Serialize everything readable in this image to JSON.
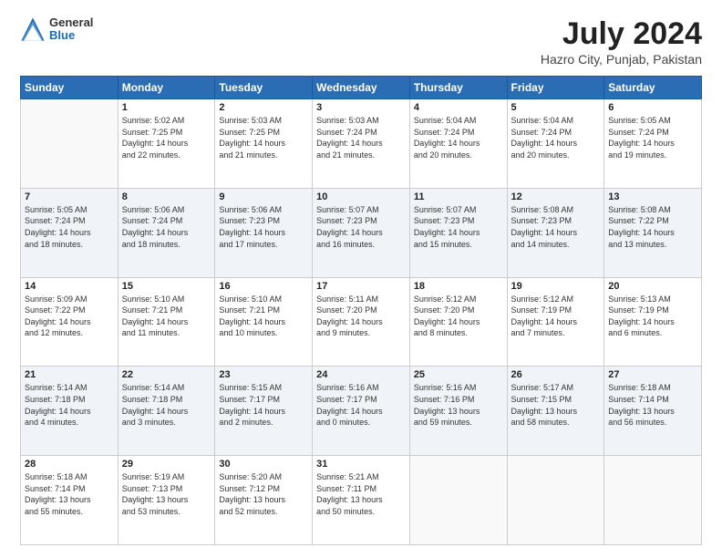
{
  "header": {
    "logo_general": "General",
    "logo_blue": "Blue",
    "month_year": "July 2024",
    "location": "Hazro City, Punjab, Pakistan"
  },
  "days_of_week": [
    "Sunday",
    "Monday",
    "Tuesday",
    "Wednesday",
    "Thursday",
    "Friday",
    "Saturday"
  ],
  "weeks": [
    [
      {
        "day": "",
        "info": ""
      },
      {
        "day": "1",
        "info": "Sunrise: 5:02 AM\nSunset: 7:25 PM\nDaylight: 14 hours\nand 22 minutes."
      },
      {
        "day": "2",
        "info": "Sunrise: 5:03 AM\nSunset: 7:25 PM\nDaylight: 14 hours\nand 21 minutes."
      },
      {
        "day": "3",
        "info": "Sunrise: 5:03 AM\nSunset: 7:24 PM\nDaylight: 14 hours\nand 21 minutes."
      },
      {
        "day": "4",
        "info": "Sunrise: 5:04 AM\nSunset: 7:24 PM\nDaylight: 14 hours\nand 20 minutes."
      },
      {
        "day": "5",
        "info": "Sunrise: 5:04 AM\nSunset: 7:24 PM\nDaylight: 14 hours\nand 20 minutes."
      },
      {
        "day": "6",
        "info": "Sunrise: 5:05 AM\nSunset: 7:24 PM\nDaylight: 14 hours\nand 19 minutes."
      }
    ],
    [
      {
        "day": "7",
        "info": "Sunrise: 5:05 AM\nSunset: 7:24 PM\nDaylight: 14 hours\nand 18 minutes."
      },
      {
        "day": "8",
        "info": "Sunrise: 5:06 AM\nSunset: 7:24 PM\nDaylight: 14 hours\nand 18 minutes."
      },
      {
        "day": "9",
        "info": "Sunrise: 5:06 AM\nSunset: 7:23 PM\nDaylight: 14 hours\nand 17 minutes."
      },
      {
        "day": "10",
        "info": "Sunrise: 5:07 AM\nSunset: 7:23 PM\nDaylight: 14 hours\nand 16 minutes."
      },
      {
        "day": "11",
        "info": "Sunrise: 5:07 AM\nSunset: 7:23 PM\nDaylight: 14 hours\nand 15 minutes."
      },
      {
        "day": "12",
        "info": "Sunrise: 5:08 AM\nSunset: 7:23 PM\nDaylight: 14 hours\nand 14 minutes."
      },
      {
        "day": "13",
        "info": "Sunrise: 5:08 AM\nSunset: 7:22 PM\nDaylight: 14 hours\nand 13 minutes."
      }
    ],
    [
      {
        "day": "14",
        "info": "Sunrise: 5:09 AM\nSunset: 7:22 PM\nDaylight: 14 hours\nand 12 minutes."
      },
      {
        "day": "15",
        "info": "Sunrise: 5:10 AM\nSunset: 7:21 PM\nDaylight: 14 hours\nand 11 minutes."
      },
      {
        "day": "16",
        "info": "Sunrise: 5:10 AM\nSunset: 7:21 PM\nDaylight: 14 hours\nand 10 minutes."
      },
      {
        "day": "17",
        "info": "Sunrise: 5:11 AM\nSunset: 7:20 PM\nDaylight: 14 hours\nand 9 minutes."
      },
      {
        "day": "18",
        "info": "Sunrise: 5:12 AM\nSunset: 7:20 PM\nDaylight: 14 hours\nand 8 minutes."
      },
      {
        "day": "19",
        "info": "Sunrise: 5:12 AM\nSunset: 7:19 PM\nDaylight: 14 hours\nand 7 minutes."
      },
      {
        "day": "20",
        "info": "Sunrise: 5:13 AM\nSunset: 7:19 PM\nDaylight: 14 hours\nand 6 minutes."
      }
    ],
    [
      {
        "day": "21",
        "info": "Sunrise: 5:14 AM\nSunset: 7:18 PM\nDaylight: 14 hours\nand 4 minutes."
      },
      {
        "day": "22",
        "info": "Sunrise: 5:14 AM\nSunset: 7:18 PM\nDaylight: 14 hours\nand 3 minutes."
      },
      {
        "day": "23",
        "info": "Sunrise: 5:15 AM\nSunset: 7:17 PM\nDaylight: 14 hours\nand 2 minutes."
      },
      {
        "day": "24",
        "info": "Sunrise: 5:16 AM\nSunset: 7:17 PM\nDaylight: 14 hours\nand 0 minutes."
      },
      {
        "day": "25",
        "info": "Sunrise: 5:16 AM\nSunset: 7:16 PM\nDaylight: 13 hours\nand 59 minutes."
      },
      {
        "day": "26",
        "info": "Sunrise: 5:17 AM\nSunset: 7:15 PM\nDaylight: 13 hours\nand 58 minutes."
      },
      {
        "day": "27",
        "info": "Sunrise: 5:18 AM\nSunset: 7:14 PM\nDaylight: 13 hours\nand 56 minutes."
      }
    ],
    [
      {
        "day": "28",
        "info": "Sunrise: 5:18 AM\nSunset: 7:14 PM\nDaylight: 13 hours\nand 55 minutes."
      },
      {
        "day": "29",
        "info": "Sunrise: 5:19 AM\nSunset: 7:13 PM\nDaylight: 13 hours\nand 53 minutes."
      },
      {
        "day": "30",
        "info": "Sunrise: 5:20 AM\nSunset: 7:12 PM\nDaylight: 13 hours\nand 52 minutes."
      },
      {
        "day": "31",
        "info": "Sunrise: 5:21 AM\nSunset: 7:11 PM\nDaylight: 13 hours\nand 50 minutes."
      },
      {
        "day": "",
        "info": ""
      },
      {
        "day": "",
        "info": ""
      },
      {
        "day": "",
        "info": ""
      }
    ]
  ]
}
